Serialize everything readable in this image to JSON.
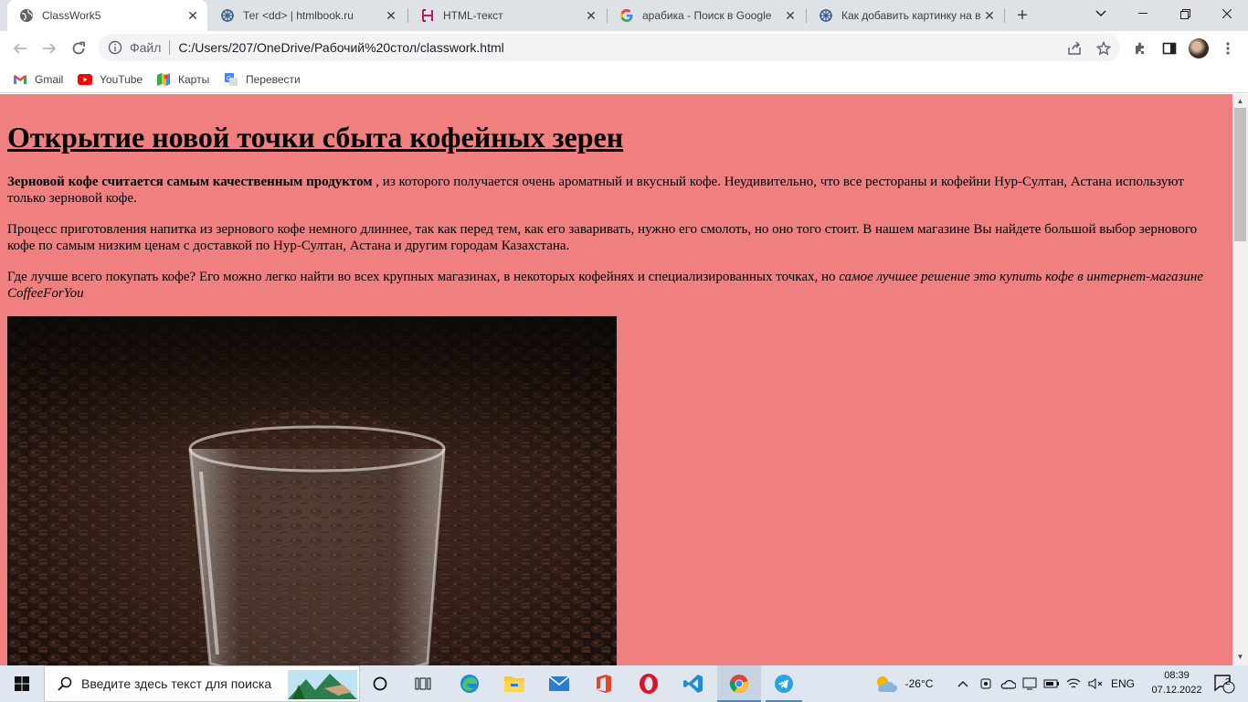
{
  "tabs": [
    {
      "title": "ClassWork5",
      "icon": "globe-icon",
      "active": true
    },
    {
      "title": "Тег <dd> | htmlbook.ru",
      "icon": "htmlbook-icon",
      "active": false
    },
    {
      "title": "HTML-текст",
      "icon": "html-text-icon",
      "active": false
    },
    {
      "title": "арабика - Поиск в Google",
      "icon": "google-icon",
      "active": false
    },
    {
      "title": "Как добавить картинку на в",
      "icon": "htmlbook-icon",
      "active": false
    }
  ],
  "address_bar": {
    "scheme_label": "Файл",
    "url": "C:/Users/207/OneDrive/Рабочий%20стол/classwork.html"
  },
  "bookmarks": [
    {
      "label": "Gmail",
      "icon": "gmail-icon"
    },
    {
      "label": "YouTube",
      "icon": "youtube-icon"
    },
    {
      "label": "Карты",
      "icon": "maps-icon"
    },
    {
      "label": "Перевести",
      "icon": "translate-icon"
    }
  ],
  "page": {
    "heading": "Открытие новой точки сбыта кофейных зерен",
    "p1_bold": "Зерновой кофе считается самым качественным продуктом",
    "p1_rest": " , из которого получается очень ароматный и вкусный кофе. Неудивительно, что все рестораны и кофейни Нур-Султан, Астана используют только зерновой кофе.",
    "p2": "Процесс приготовления напитка из зернового кофе немного длиннее, так как перед тем, как его заваривать, нужно его смолоть, но оно того стоит. В нашем магазине Вы найдете большой выбор зернового кофе по самым низким ценам с доставкой по Нур-Султан, Астана и другим городам Казахстана.",
    "p3_plain": "Где лучше всего покупать кофе? Его можно легко найти во всех крупных магазинах, в некоторых кофейнях и специализированных точках, но ",
    "p3_italic": "самое лучшее решение это купить кофе в интернет-магазине CoffeeForYou",
    "background_color": "#f08080"
  },
  "taskbar": {
    "search_placeholder": "Введите здесь текст для поиска",
    "weather": "-26°C",
    "language": "ENG",
    "time": "08:39",
    "date": "07.12.2022",
    "notifications": "2"
  }
}
